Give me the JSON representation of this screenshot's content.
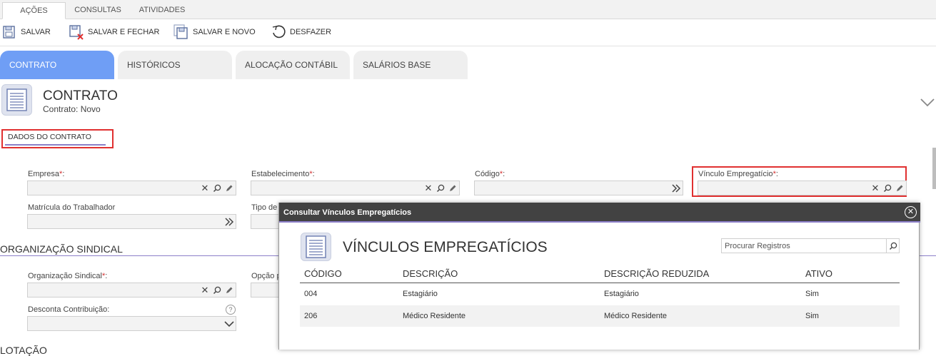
{
  "top_tabs": [
    "AÇÕES",
    "CONSULTAS",
    "ATIVIDADES"
  ],
  "toolbar": {
    "save": "SALVAR",
    "save_close": "SALVAR E FECHAR",
    "save_new": "SALVAR E NOVO",
    "undo": "DESFAZER"
  },
  "section_tabs": [
    "CONTRATO",
    "HISTÓRICOS",
    "ALOCAÇÃO CONTÁBIL",
    "SALÁRIOS BASE"
  ],
  "header": {
    "title": "CONTRATO",
    "subtitle": "Contrato: Novo"
  },
  "subtab": "DADOS DO CONTRATO",
  "fields": {
    "empresa": "Empresa",
    "estabelecimento": "Estabelecimento",
    "codigo": "Código",
    "vinculo": "Vínculo Empregatício",
    "matricula": "Matrícula do Trabalhador",
    "tipo": "Tipo de",
    "org_sindical": "Organização Sindical",
    "opcao": "Opção p",
    "desconta": "Desconta Contribuição:"
  },
  "req_mark": "*",
  "colon": ":",
  "section_org": "ORGANIZAÇÃO SINDICAL",
  "section_cut": "LOTAÇÃO",
  "modal": {
    "title": "Consultar Vínculos Empregatícios",
    "heading": "VÍNCULOS EMPREGATÍCIOS",
    "search_placeholder": "Procurar Registros",
    "columns": [
      "CÓDIGO",
      "DESCRIÇÃO",
      "DESCRIÇÃO REDUZIDA",
      "ATIVO"
    ],
    "rows": [
      [
        "004",
        "Estagiário",
        "Estagiário",
        "Sim"
      ],
      [
        "206",
        "Médico Residente",
        "Médico Residente",
        "Sim"
      ]
    ]
  },
  "icons": {
    "save": "floppy-icon",
    "save_close": "floppy-close-icon",
    "save_new": "floppy-new-icon",
    "undo": "undo-icon",
    "clear": "clear-icon",
    "search": "magnifier-icon",
    "edit": "pencil-icon",
    "next": "double-chevron-icon",
    "help": "help-icon"
  },
  "colors": {
    "active_tab": "#6f9ef5",
    "accent_line": "#8c7fc9",
    "highlight": "#e03030",
    "modal_header": "#424242"
  }
}
